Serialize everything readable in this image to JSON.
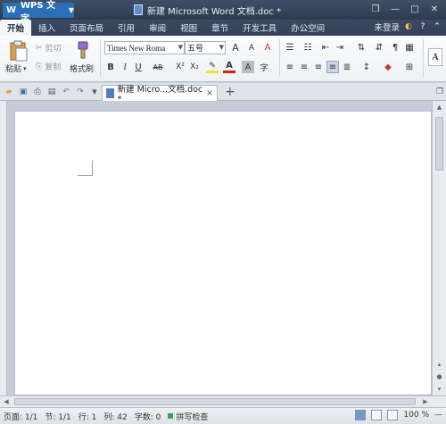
{
  "titlebar": {
    "app_label": "WPS 文字",
    "app_logo": "W",
    "doc_title": "新建 Microsoft Word 文档.doc *"
  },
  "menu": {
    "tabs": [
      "开始",
      "插入",
      "页面布局",
      "引用",
      "审阅",
      "视图",
      "章节",
      "开发工具",
      "办公空间"
    ],
    "login": "未登录"
  },
  "ribbon": {
    "paste": "粘贴",
    "cut": "剪切",
    "copy": "复制",
    "format_painter": "格式刷",
    "font_name": "Times New Roma",
    "font_size": "五号",
    "bold": "B",
    "italic": "I",
    "underline": "U",
    "strike": "AB",
    "superscript": "X²",
    "subscript": "X₂",
    "font_color": "A",
    "char_shade": "A",
    "grow_font": "A",
    "shrink_font": "A",
    "clear_format": "A",
    "style_letter": "A"
  },
  "quick_access": {
    "doc_tab": "新建 Micro...文档.doc *",
    "close": "×",
    "new_tab": "+"
  },
  "status": {
    "page": "页面: 1/1",
    "section": "节: 1/1",
    "row": "行: 1",
    "column": "列: 42",
    "word_count": "字数: 0",
    "spell_check": "拼写检查",
    "zoom": "100 %"
  },
  "colors": {
    "titlebar": "#33415a",
    "app_button": "#2b6fb8",
    "page": "#ffffff",
    "workspace": "#c6cdd6"
  }
}
